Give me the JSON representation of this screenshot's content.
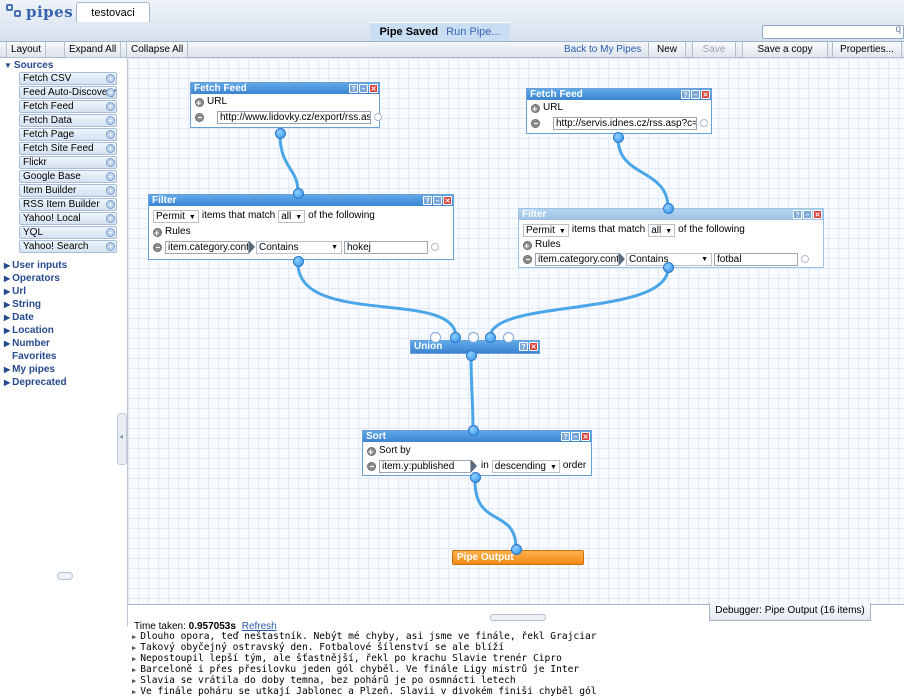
{
  "app": {
    "logo_text": "pipes",
    "pipe_name": "testovaci"
  },
  "status": {
    "saved": "Pipe Saved",
    "run": "Run Pipe..."
  },
  "toolbar": {
    "layout": "Layout",
    "expand_all": "Expand All",
    "collapse_all": "Collapse All",
    "back": "Back to My Pipes",
    "new": "New",
    "save": "Save",
    "save_copy": "Save a copy",
    "properties": "Properties..."
  },
  "library": {
    "sources_label": "Sources",
    "sources": [
      "Fetch CSV",
      "Feed Auto-Discovery",
      "Fetch Feed",
      "Fetch Data",
      "Fetch Page",
      "Fetch Site Feed",
      "Flickr",
      "Google Base",
      "Item Builder",
      "RSS Item Builder",
      "Yahoo! Local",
      "YQL",
      "Yahoo! Search"
    ],
    "sections": [
      "User inputs",
      "Operators",
      "Url",
      "String",
      "Date",
      "Location",
      "Number"
    ],
    "favorites": "Favorites",
    "more_sections": [
      "My pipes",
      "Deprecated"
    ]
  },
  "modules": {
    "fetch1": {
      "title": "Fetch Feed",
      "url_label": "URL",
      "url": "http://www.lidovky.cz/export/rss.as"
    },
    "fetch2": {
      "title": "Fetch Feed",
      "url_label": "URL",
      "url": "http://servis.idnes.cz/rss.asp?c=s"
    },
    "filter1": {
      "title": "Filter",
      "mode": "Permit",
      "text1": "items that match",
      "match": "all",
      "text2": "of the following",
      "rules_label": "Rules",
      "field": "item.category.conten",
      "op": "Contains",
      "value": "hokej"
    },
    "filter2": {
      "title": "Filter",
      "mode": "Permit",
      "text1": "items that match",
      "match": "all",
      "text2": "of the following",
      "rules_label": "Rules",
      "field": "item.category.conten",
      "op": "Contains",
      "value": "fotbal"
    },
    "union": {
      "title": "Union"
    },
    "sort": {
      "title": "Sort",
      "sortby_label": "Sort by",
      "field": "item.y:published",
      "in": "in",
      "order": "descending",
      "order_label": "order"
    },
    "output": {
      "title": "Pipe Output"
    }
  },
  "debugger": {
    "tab": "Debugger: Pipe Output (16 items)",
    "time_label": "Time taken:",
    "time_value": "0.957053s",
    "refresh": "Refresh",
    "items": [
      "Dlouho opora, teď neštastník. Nebýt mé chyby, asi jsme ve finále, řekl Grajciar",
      "Takový obyčejný ostravský den. Fotbalové šílenství se ale blíží",
      "Nepostoupil lepší tým, ale šťastnější, řekl po krachu Slavie trenér Cipro",
      "Barceloně i přes přesilovku jeden gól chyběl. Ve finále Ligy mistrů je Inter",
      "Slavia se vrátila do doby temna, bez pohárů je po osmnácti letech",
      "Ve finále poháru se utkají Jablonec a Plzeň. Slavii v divokém finiši chyběl gól"
    ]
  }
}
